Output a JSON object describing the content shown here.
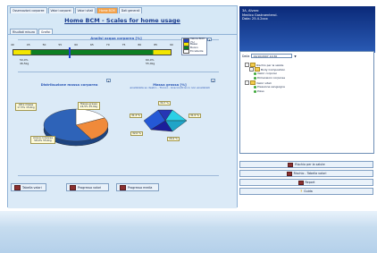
{
  "tabs": [
    "Osservazioni corporee",
    "Valori corporei",
    "Valori vitali",
    "Home BCM",
    "Dati generali"
  ],
  "active_tab_index": 3,
  "subtabs": [
    "Risultati misura",
    "Grafici"
  ],
  "active_subtab_index": 1,
  "page_title": "Home BCM - Scales for home usage",
  "gauge": {
    "title": "Analisi acqua corporea [%]",
    "ticks": [
      "40",
      "45",
      "50",
      "55",
      "60",
      "65",
      "70",
      "75",
      "80",
      "85",
      "90"
    ],
    "left_labels": [
      "50,0%",
      "46,5kg"
    ],
    "right_labels": [
      "60,0%",
      "55,0kg"
    ],
    "marker_value_pct": 58
  },
  "legend": {
    "items": [
      {
        "label": "Valore BCM (%)",
        "color": "#2244cc"
      },
      {
        "label": "Basso",
        "color": "#f3e600"
      },
      {
        "label": "Buono",
        "color": "#0d7f23"
      },
      {
        "label": "Eccellente",
        "color": "#ffffff"
      }
    ]
  },
  "pie1": {
    "title": "Distribuzione massa corporea",
    "callouts": [
      "Altre masse\n17,5% 15,0kg",
      "Massa grassa\n24,5% 25,0kg",
      "Acqua corporea\n58,0% 55,0kg"
    ],
    "slices": [
      {
        "value": 17.5,
        "color": "#ffffff"
      },
      {
        "value": 24.5,
        "color": "#f08a3a"
      },
      {
        "value": 58.0,
        "color": "#2e63b8"
      }
    ]
  },
  "pie2": {
    "title": "Massa grassa [%]",
    "subtitle": "analizzata su destro - Tronco - braccio/tronco non analizzati",
    "callouts": [
      "34,7 %",
      "31,5 %",
      "29,4 %",
      "31,3 %",
      "32,0 %"
    ]
  },
  "bottom_buttons": [
    "Tabella valori",
    "Progresso valori",
    "Progresso media"
  ],
  "right_panel": {
    "header_lines": [
      "3A, Alvaro",
      "Medico Gastroenterol.",
      "Data: 25.4.2xxx"
    ],
    "date_label": "Dalla",
    "date_value": "19/10/2007 10:30",
    "tree": [
      {
        "label": "Rischio per la salute",
        "indent": 0,
        "kind": "folder",
        "exp": "-"
      },
      {
        "label": "Body Composition",
        "indent": 1,
        "kind": "folder",
        "exp": "-"
      },
      {
        "label": "Valori corporei",
        "indent": 2,
        "kind": "dot",
        "exp": ""
      },
      {
        "label": "Dimensioni corporee",
        "indent": 2,
        "kind": "dot",
        "exp": ""
      },
      {
        "label": "Valori vitali",
        "indent": 0,
        "kind": "folder",
        "exp": "-"
      },
      {
        "label": "Pressione sanguigna",
        "indent": 2,
        "kind": "dot",
        "exp": ""
      },
      {
        "label": "Polso",
        "indent": 2,
        "kind": "dot",
        "exp": ""
      }
    ],
    "buttons": [
      "Rischio per la salute",
      "Rischio - Tabella valori",
      "Report",
      "Guida"
    ]
  }
}
